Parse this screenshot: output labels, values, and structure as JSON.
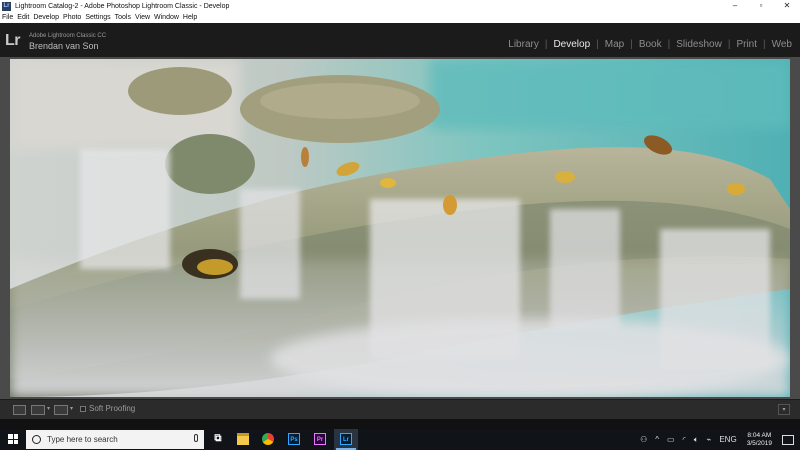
{
  "window": {
    "title": "Lightroom Catalog-2 - Adobe Photoshop Lightroom Classic - Develop",
    "controls": [
      "–",
      "▫",
      "✕"
    ]
  },
  "menu": {
    "items": [
      "File",
      "Edit",
      "Develop",
      "Photo",
      "Settings",
      "Tools",
      "View",
      "Window",
      "Help"
    ]
  },
  "identity": {
    "logo": "Lr",
    "product": "Adobe Lightroom Classic CC",
    "user": "Brendan van Son"
  },
  "modules": {
    "items": [
      "Library",
      "Develop",
      "Map",
      "Book",
      "Slideshow",
      "Print",
      "Web"
    ],
    "active": "Develop"
  },
  "toolbar": {
    "soft_proofing_label": "Soft Proofing"
  },
  "taskbar": {
    "search_placeholder": "Type here to search",
    "apps": [
      {
        "name": "task-view",
        "glyph": "⧉",
        "color": "#ffffff"
      },
      {
        "name": "file-explorer",
        "glyph": "",
        "color": "#f2c94c"
      },
      {
        "name": "chrome",
        "glyph": "",
        "color": "#e94235"
      },
      {
        "name": "photoshop",
        "glyph": "Ps",
        "color": "#31a8ff"
      },
      {
        "name": "premiere",
        "glyph": "Pr",
        "color": "#ea77ff"
      },
      {
        "name": "lightroom",
        "glyph": "Lr",
        "color": "#31a8ff"
      }
    ],
    "tray": {
      "language": "ENG",
      "time": "8:04 AM",
      "date": "3/5/2019"
    }
  },
  "colors": {
    "accent": "#7cb4e6",
    "panel": "#2b2b2b",
    "identity_bg": "#1b1b1b"
  }
}
